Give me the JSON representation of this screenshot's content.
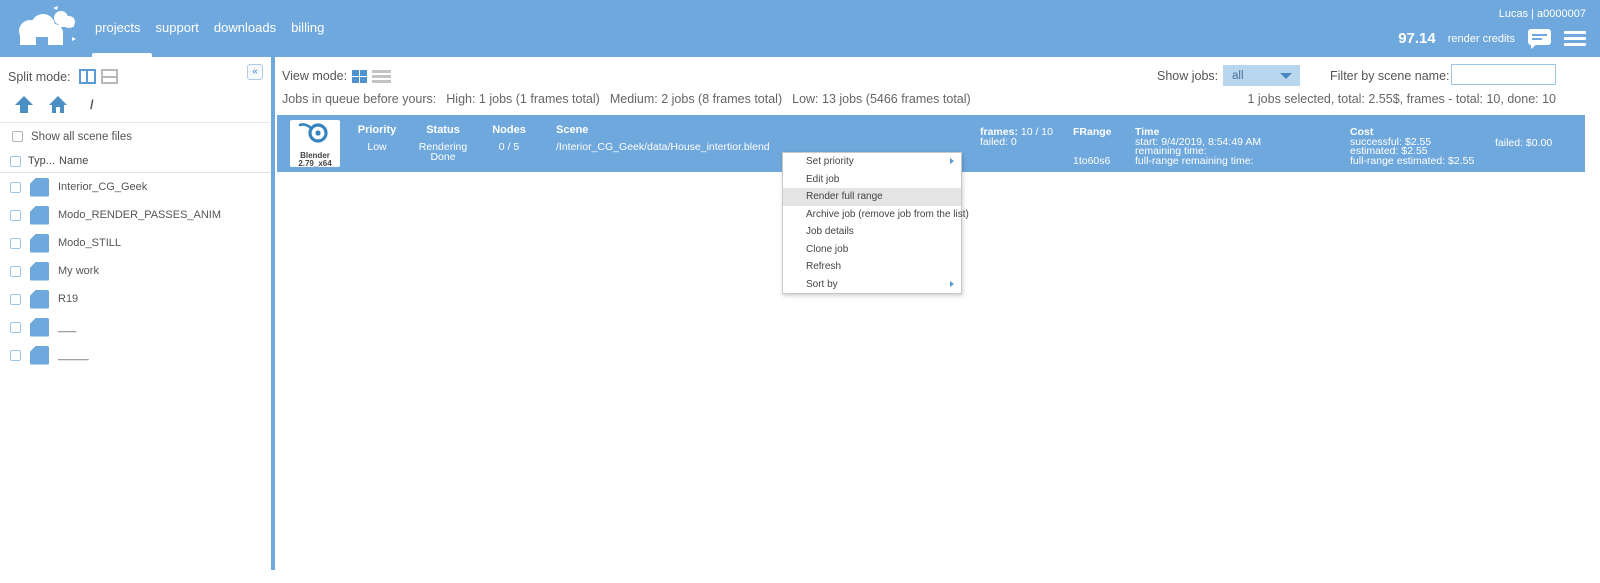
{
  "topbar": {
    "nav": [
      {
        "label": "projects"
      },
      {
        "label": "support"
      },
      {
        "label": "downloads"
      },
      {
        "label": "billing"
      }
    ],
    "user": "Lucas | a0000007",
    "credits_value": "97.14",
    "credits_label": "render credits"
  },
  "sidebar": {
    "split_mode_label": "Split mode:",
    "path_separator": "/",
    "show_all_label": "Show all scene files",
    "col_type": "Typ...",
    "col_name": "Name",
    "collapse_glyph": "«",
    "items": [
      {
        "name": "Interior_CG_Geek"
      },
      {
        "name": "Modo_RENDER_PASSES_ANIM"
      },
      {
        "name": "Modo_STILL"
      },
      {
        "name": "My work"
      },
      {
        "name": "R19"
      },
      {
        "name": "___"
      },
      {
        "name": "_____"
      }
    ]
  },
  "main": {
    "view_mode_label": "View mode:",
    "queue": {
      "prefix": "Jobs in queue before yours:",
      "high": "High: 1 jobs (1 frames total)",
      "medium": "Medium: 2 jobs (8 frames total)",
      "low": "Low: 13 jobs (5466 frames total)"
    },
    "show_jobs_label": "Show jobs:",
    "show_jobs_value": "all",
    "filter_label": "Filter by scene name:",
    "selection_summary": "1 jobs selected, total: 2.55$, frames - total: 10, done: 10"
  },
  "job": {
    "app_name": "Blender",
    "app_version": "2.79_x64",
    "priority_header": "Priority",
    "priority_value": "Low",
    "status_header": "Status",
    "status_value": "Rendering Done",
    "nodes_header": "Nodes",
    "nodes_value": "0 / 5",
    "scene_header": "Scene",
    "scene_value": "/Interior_CG_Geek/data/House_intertior.blend",
    "frames_label": "frames:",
    "frames_value": "10 / 10",
    "frames_failed": "failed: 0",
    "frange_header": "FRange",
    "frange_value": "1to60s6",
    "time_header": "Time",
    "time_start": "start: 9/4/2019, 8:54:49 AM",
    "time_remaining": "remaining time:",
    "time_full_range": "full-range remaining time:",
    "cost_header": "Cost",
    "cost_successful": "successful: $2.55",
    "cost_estimated": "estimated: $2.55",
    "cost_full_range": "full-range estimated: $2.55",
    "cost_failed": "failed: $0.00"
  },
  "context_menu": {
    "items": [
      {
        "label": "Set priority",
        "submenu": true
      },
      {
        "label": "Edit job",
        "submenu": false
      },
      {
        "label": "Render full range",
        "submenu": false,
        "highlighted": true
      },
      {
        "label": "Archive job (remove job from the list)",
        "submenu": false
      },
      {
        "label": "Job details",
        "submenu": false
      },
      {
        "label": "Clone job",
        "submenu": false
      },
      {
        "label": "Refresh",
        "submenu": false
      },
      {
        "label": "Sort by",
        "submenu": true
      }
    ]
  },
  "colors": {
    "header_blue": "#6fa8dc",
    "accent_blue": "#5b9bd5",
    "icon_blue": "#4a90c4",
    "dropdown_bg": "#b9d6ef",
    "text_gray": "#555555",
    "menu_highlight": "#e4e4e4"
  }
}
